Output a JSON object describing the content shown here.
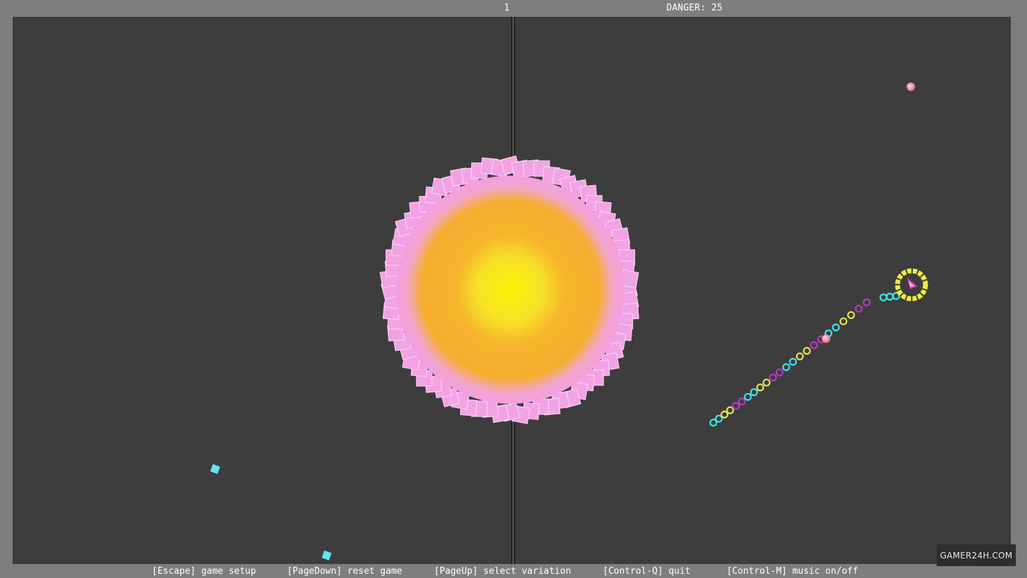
{
  "hud": {
    "score": "1",
    "danger": "DANGER: 25"
  },
  "help": [
    "[Escape] game setup",
    "[PageDown] reset game",
    "[PageUp] select variation",
    "[Control-Q] quit",
    "[Control-M] music on/off"
  ],
  "watermark": "GAMER24H.COM",
  "colors": {
    "frame": "#7f7e7f",
    "field": "#3e3d3e",
    "sun_core": "#f8ee10",
    "sun_glow": "#f6b22a",
    "sun_corona": "#f2a0dd",
    "snake_cyan": "#3fe3ea",
    "snake_yellow": "#e4e64a",
    "snake_magenta": "#b43cbe",
    "ship_ring": "#f0f03c",
    "ship": "#e23fc4",
    "food_pink": "#f07aa0",
    "crystal": "#5ce8f0"
  },
  "icons": [
    "sun-icon",
    "ship-icon",
    "snake-segment-icon",
    "crystal-icon",
    "orb-icon"
  ]
}
